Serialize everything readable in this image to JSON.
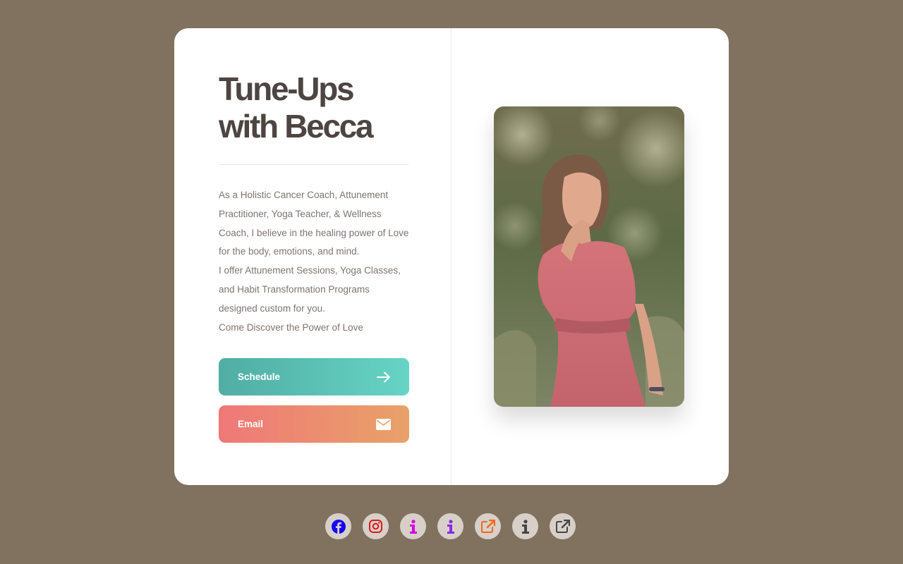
{
  "profile": {
    "title_line1": "Tune-Ups",
    "title_line2": "with Becca",
    "bio": [
      "As a Holistic Cancer Coach, Attunement Practitioner, Yoga Teacher, & Wellness Coach, I believe in the healing power of Love for the body, emotions, and mind.",
      "I offer Attunement Sessions, Yoga Classes, and Habit Transformation Programs designed custom for you.",
      "Come Discover the Power of Love"
    ]
  },
  "buttons": {
    "schedule_label": "Schedule",
    "email_label": "Email"
  },
  "social_links": [
    {
      "icon": "facebook-icon",
      "color": "#1500ff"
    },
    {
      "icon": "instagram-icon",
      "color": "#d81b1b"
    },
    {
      "icon": "info-icon",
      "color": "#d800e0"
    },
    {
      "icon": "info-icon",
      "color": "#8a2be2"
    },
    {
      "icon": "external-link-icon",
      "color": "#f0671e"
    },
    {
      "icon": "info-icon",
      "color": "#454545"
    },
    {
      "icon": "external-link-icon",
      "color": "#454545"
    }
  ],
  "colors": {
    "page_background": "#80725f",
    "card_background": "#ffffff",
    "title_color": "#4d4542",
    "schedule_gradient": [
      "#50ada3",
      "#66d4c5"
    ],
    "email_gradient": [
      "#ef7878",
      "#e8a268"
    ]
  }
}
